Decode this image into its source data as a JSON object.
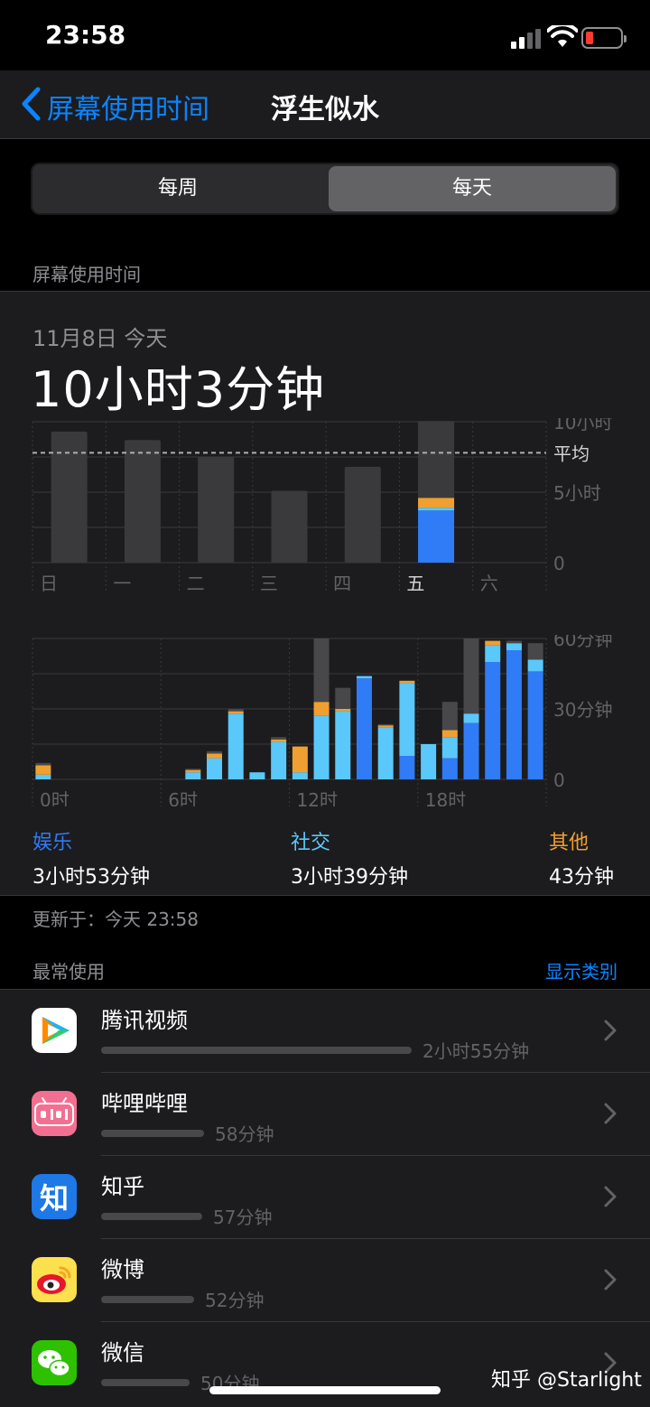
{
  "status": {
    "time": "23:58"
  },
  "nav": {
    "back_label": "屏幕使用时间",
    "title": "浮生似水"
  },
  "segment": {
    "weekly": "每周",
    "daily": "每天",
    "selected": "daily"
  },
  "section_title": "屏幕使用时间",
  "summary": {
    "date": "11月8日 今天",
    "total": "10小时3分钟"
  },
  "chart_data": [
    {
      "type": "bar",
      "categories": [
        "日",
        "一",
        "二",
        "三",
        "四",
        "五",
        "六"
      ],
      "series": [
        {
          "values": [
            9.3,
            8.7,
            7.5,
            5.1,
            6.8,
            10.05,
            0
          ]
        }
      ],
      "today_breakdown": {
        "blue": 3.7,
        "light_blue": 0.2,
        "orange": 0.7,
        "gray": 5.45
      },
      "average": 7.8,
      "avg_label": "平均",
      "y_tick_labels": [
        "10小时",
        "5小时",
        "0"
      ],
      "ylim": [
        0,
        10
      ],
      "colors": {
        "other_days": "#3a3a3c",
        "blue": "#2f7cf6",
        "light_blue": "#5ac8fa",
        "orange": "#f0a030",
        "gray": "#3a3a3c"
      }
    },
    {
      "type": "bar",
      "x": [
        0,
        1,
        2,
        3,
        4,
        5,
        6,
        7,
        8,
        9,
        10,
        11,
        12,
        13,
        14,
        15,
        16,
        17,
        18,
        19,
        20,
        21,
        22,
        23
      ],
      "x_tick_labels": [
        "0时",
        "6时",
        "12时",
        "18时"
      ],
      "y_tick_labels": [
        "60分钟",
        "30分钟",
        "0"
      ],
      "ylim": [
        0,
        60
      ],
      "series": [
        {
          "values": [
            0,
            0,
            0,
            0,
            0,
            0,
            0,
            0,
            0,
            0,
            0,
            0,
            0,
            0,
            0,
            0,
            0,
            0,
            0,
            0,
            0,
            0,
            0,
            0
          ],
          "color": "#2f7cf6"
        },
        {
          "values": [
            0,
            0,
            0,
            0,
            0,
            0,
            0,
            0,
            0,
            0,
            0,
            0,
            0,
            0,
            0,
            0,
            0,
            0,
            0,
            0,
            0,
            0,
            0,
            0
          ],
          "color": "#5ac8fa"
        }
      ],
      "stacks": [
        [
          0,
          2,
          4,
          1
        ],
        [
          0,
          0,
          0,
          0
        ],
        [
          0,
          0,
          0,
          0
        ],
        [
          0,
          0,
          0,
          0
        ],
        [
          0,
          0,
          0,
          0
        ],
        [
          0,
          0,
          0,
          0
        ],
        [
          0,
          0,
          0,
          0
        ],
        [
          0,
          3,
          1,
          0.5
        ],
        [
          0,
          9,
          2,
          1
        ],
        [
          0,
          28,
          1,
          1
        ],
        [
          0,
          3,
          0,
          0
        ],
        [
          0,
          16,
          1,
          1
        ],
        [
          0,
          3,
          11,
          0
        ],
        [
          0,
          27,
          6,
          27
        ],
        [
          0,
          29,
          1,
          9
        ],
        [
          43,
          1,
          0,
          0
        ],
        [
          0,
          22,
          1,
          0.5
        ],
        [
          10,
          31,
          1,
          0
        ],
        [
          0,
          15,
          0,
          0
        ],
        [
          9,
          9,
          3,
          12
        ],
        [
          24,
          4,
          0,
          60
        ],
        [
          50,
          7,
          2,
          0
        ],
        [
          55,
          3,
          0,
          1
        ],
        [
          46,
          5,
          0,
          7
        ]
      ],
      "stack_order": [
        "blue",
        "light_blue",
        "orange",
        "gray"
      ],
      "colors": {
        "blue": "#2f7cf6",
        "light_blue": "#5ac8fa",
        "orange": "#f0a030",
        "gray": "#48484a"
      }
    }
  ],
  "categories": [
    {
      "label": "娱乐",
      "value": "3小时53分钟",
      "color": "#2f7cf6"
    },
    {
      "label": "社交",
      "value": "3小时39分钟",
      "color": "#5ac8fa"
    },
    {
      "label": "其他",
      "value": "43分钟",
      "color": "#f0a030"
    }
  ],
  "updated": "更新于：今天 23:58",
  "most_used": {
    "title": "最常使用",
    "action": "显示类别"
  },
  "apps": [
    {
      "name": "腾讯视频",
      "time": "2小时55分钟",
      "fraction": 1.0,
      "icon": "tencent-video-icon"
    },
    {
      "name": "哔哩哔哩",
      "time": "58分钟",
      "fraction": 0.33,
      "icon": "bilibili-icon"
    },
    {
      "name": "知乎",
      "time": "57分钟",
      "fraction": 0.325,
      "icon": "zhihu-icon",
      "icon_text": "知"
    },
    {
      "name": "微博",
      "time": "52分钟",
      "fraction": 0.3,
      "icon": "weibo-icon"
    },
    {
      "name": "微信",
      "time": "50分钟",
      "fraction": 0.285,
      "icon": "wechat-icon"
    }
  ],
  "watermark": "知乎 @Starlight"
}
